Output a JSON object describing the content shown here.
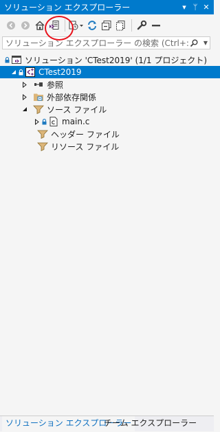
{
  "titlebar": {
    "title": "ソリューション エクスプローラー",
    "dropdown_glyph": "▾",
    "pin_glyph": "ᛘ",
    "close_glyph": "✕"
  },
  "toolbar": {
    "icons": [
      "back-icon",
      "forward-icon",
      "home-icon",
      "switch-views-icon",
      "pending-changes-filter-icon",
      "sync-icon",
      "collapse-all-icon",
      "show-all-files-icon",
      "properties-icon",
      "preview-icon"
    ],
    "highlight_color": "#e8101a"
  },
  "search": {
    "placeholder": "ソリューション エクスプローラー の検索 (Ctrl+:)",
    "value": ""
  },
  "tree": {
    "solution": {
      "label": "ソリューション 'CTest2019' (1/1 プロジェクト)"
    },
    "project": {
      "label": "CTest2019"
    },
    "references": {
      "label": "参照"
    },
    "external_deps": {
      "label": "外部依存関係"
    },
    "source_files": {
      "label": "ソース ファイル"
    },
    "main_c": {
      "label": "main.c"
    },
    "header_files": {
      "label": "ヘッダー ファイル"
    },
    "resource_files": {
      "label": "リソース ファイル"
    }
  },
  "bottom_tabs": {
    "solution_explorer": "ソリューション エクスプローラー",
    "team_explorer": "チーム エクスプローラー"
  },
  "colors": {
    "accent": "#007acc",
    "background": "#f5f5f5",
    "folder": "#dcb67a",
    "vs_purple": "#68217a"
  }
}
